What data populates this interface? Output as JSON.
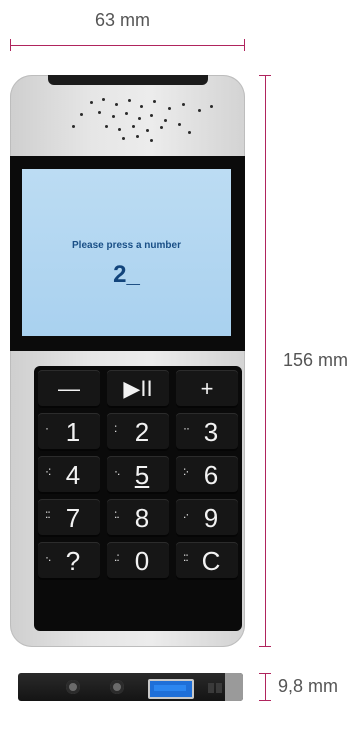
{
  "dimensions": {
    "width": "63 mm",
    "height": "156 mm",
    "depth": "9,8 mm"
  },
  "screen": {
    "prompt": "Please press a number",
    "entry": "2_",
    "background_color": "#a9d1ef",
    "text_color": "#12447b"
  },
  "keypad": {
    "keys": [
      {
        "label": "—",
        "dots": "",
        "name": "volume-down-key"
      },
      {
        "label": "▶II",
        "dots": "",
        "name": "play-pause-key"
      },
      {
        "label": "+",
        "dots": "",
        "name": "volume-up-key"
      },
      {
        "label": "1",
        "dots": "·",
        "name": "key-1"
      },
      {
        "label": "2",
        "dots": ":",
        "name": "key-2"
      },
      {
        "label": "3",
        "dots": "··",
        "name": "key-3"
      },
      {
        "label": "4",
        "dots": "·:",
        "name": "key-4"
      },
      {
        "label": "5",
        "dots": "·.",
        "name": "key-5"
      },
      {
        "label": "6",
        "dots": ":·",
        "name": "key-6"
      },
      {
        "label": "7",
        "dots": "::",
        "name": "key-7"
      },
      {
        "label": "8",
        "dots": ":.",
        "name": "key-8"
      },
      {
        "label": "9",
        "dots": ".·",
        "name": "key-9"
      },
      {
        "label": "?",
        "dots": "·.",
        "name": "key-question"
      },
      {
        "label": "0",
        "dots": ".:",
        "name": "key-0"
      },
      {
        "label": "C",
        "dots": "::",
        "name": "key-clear"
      }
    ]
  },
  "colors": {
    "dimension_line": "#b0245d",
    "device_body": "#e6e6e6",
    "keypad": "#0a0a0a",
    "usb_port": "#1f6fd8"
  },
  "icons": [
    "speaker-grille-icon",
    "play-pause-icon",
    "usb-port-icon",
    "audio-jack-icon"
  ]
}
